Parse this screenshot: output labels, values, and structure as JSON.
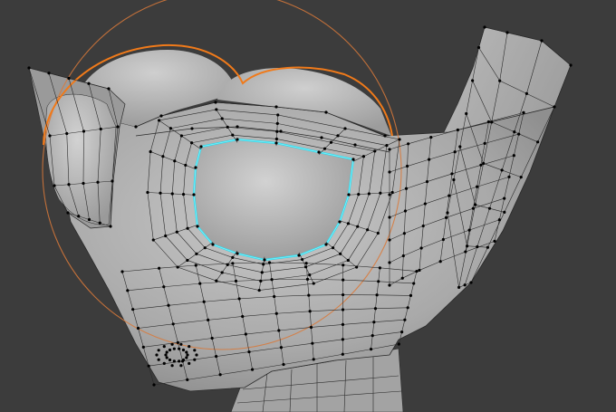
{
  "viewport": {
    "background": "#3c3c3c",
    "mesh_fill": "#a8a8a8",
    "mesh_fill_light": "#cdcdcd",
    "mesh_fill_dark": "#8d8d8d",
    "wire_color": "#2a2a2a",
    "vertex_color": "#000000",
    "selected_object_outline": "#f07a1a",
    "selected_edge_loop": "#35d7e8",
    "proportional_circle": "#d9793a"
  }
}
